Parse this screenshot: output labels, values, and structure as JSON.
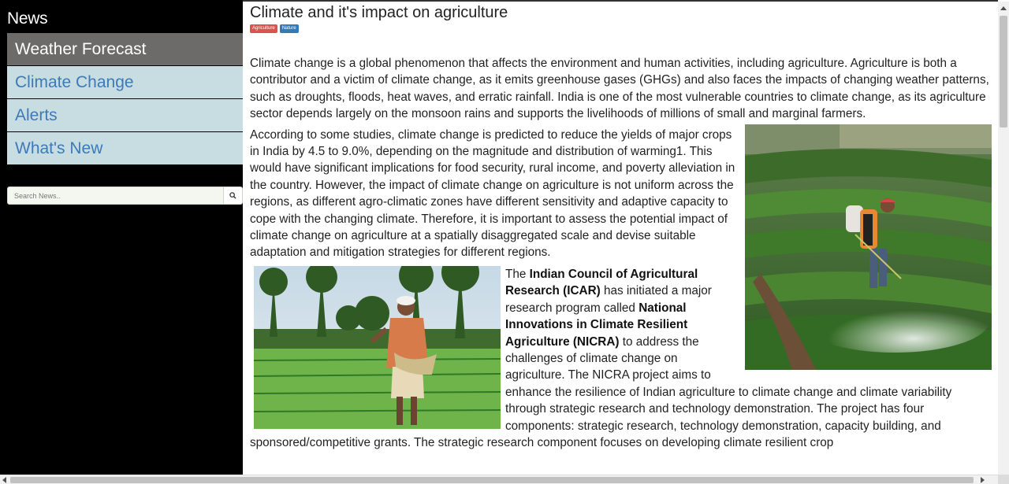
{
  "sidebar": {
    "brand": "News",
    "nav": [
      {
        "label": "Weather Forecast",
        "active": true
      },
      {
        "label": "Climate Change",
        "active": false
      },
      {
        "label": "Alerts",
        "active": false
      },
      {
        "label": "What's New",
        "active": false
      }
    ],
    "search": {
      "placeholder": "Search News..",
      "icon": "search-icon"
    }
  },
  "article": {
    "title": "Climate and it's impact on agriculture",
    "tags": [
      "Agriculture",
      "Nature"
    ],
    "p1": "Climate change is a global phenomenon that affects the environment and human activities, including agriculture. Agriculture is both a contributor and a victim of climate change, as it emits greenhouse gases (GHGs) and also faces the impacts of changing weather patterns, such as droughts, floods, heat waves, and erratic rainfall. India is one of the most vulnerable countries to climate change, as its agriculture sector depends largely on the monsoon rains and supports the livelihoods of millions of small and marginal farmers.",
    "p2": "According to some studies, climate change is predicted to reduce the yields of major crops in India by 4.5 to 9.0%, depending on the magnitude and distribution of warming1. This would have significant implications for food security, rural income, and poverty alleviation in the country. However, the impact of climate change on agriculture is not uniform across the regions, as different agro-climatic zones have different sensitivity and adaptive capacity to cope with the changing climate. Therefore, it is important to assess the potential impact of climate change on agriculture at a spatially disaggregated scale and devise suitable adaptation and mitigation strategies for different regions.",
    "p3": {
      "t1": "The ",
      "b1": "Indian Council of Agricultural Research (ICAR)",
      "t2": " has initiated a major research program called ",
      "b2": "National Innovations in Climate Resilient Agriculture (NICRA)",
      "t3": " to address the challenges of climate change on agriculture. The NICRA project aims to enhance the resilience of Indian agriculture to climate change and climate variability through strategic research and technology demonstration. The project has four components: strategic research, technology demonstration, capacity building, and sponsored/competitive grants. The strategic research component focuses on developing climate resilient crop"
    }
  },
  "colors": {
    "sidebar_bg": "#000000",
    "nav_active_bg": "#6c6b6a",
    "nav_bg": "#c7dde1",
    "nav_text": "#3c7ab8",
    "tag_agriculture": "#d9534f",
    "tag_nature": "#337ab7"
  }
}
